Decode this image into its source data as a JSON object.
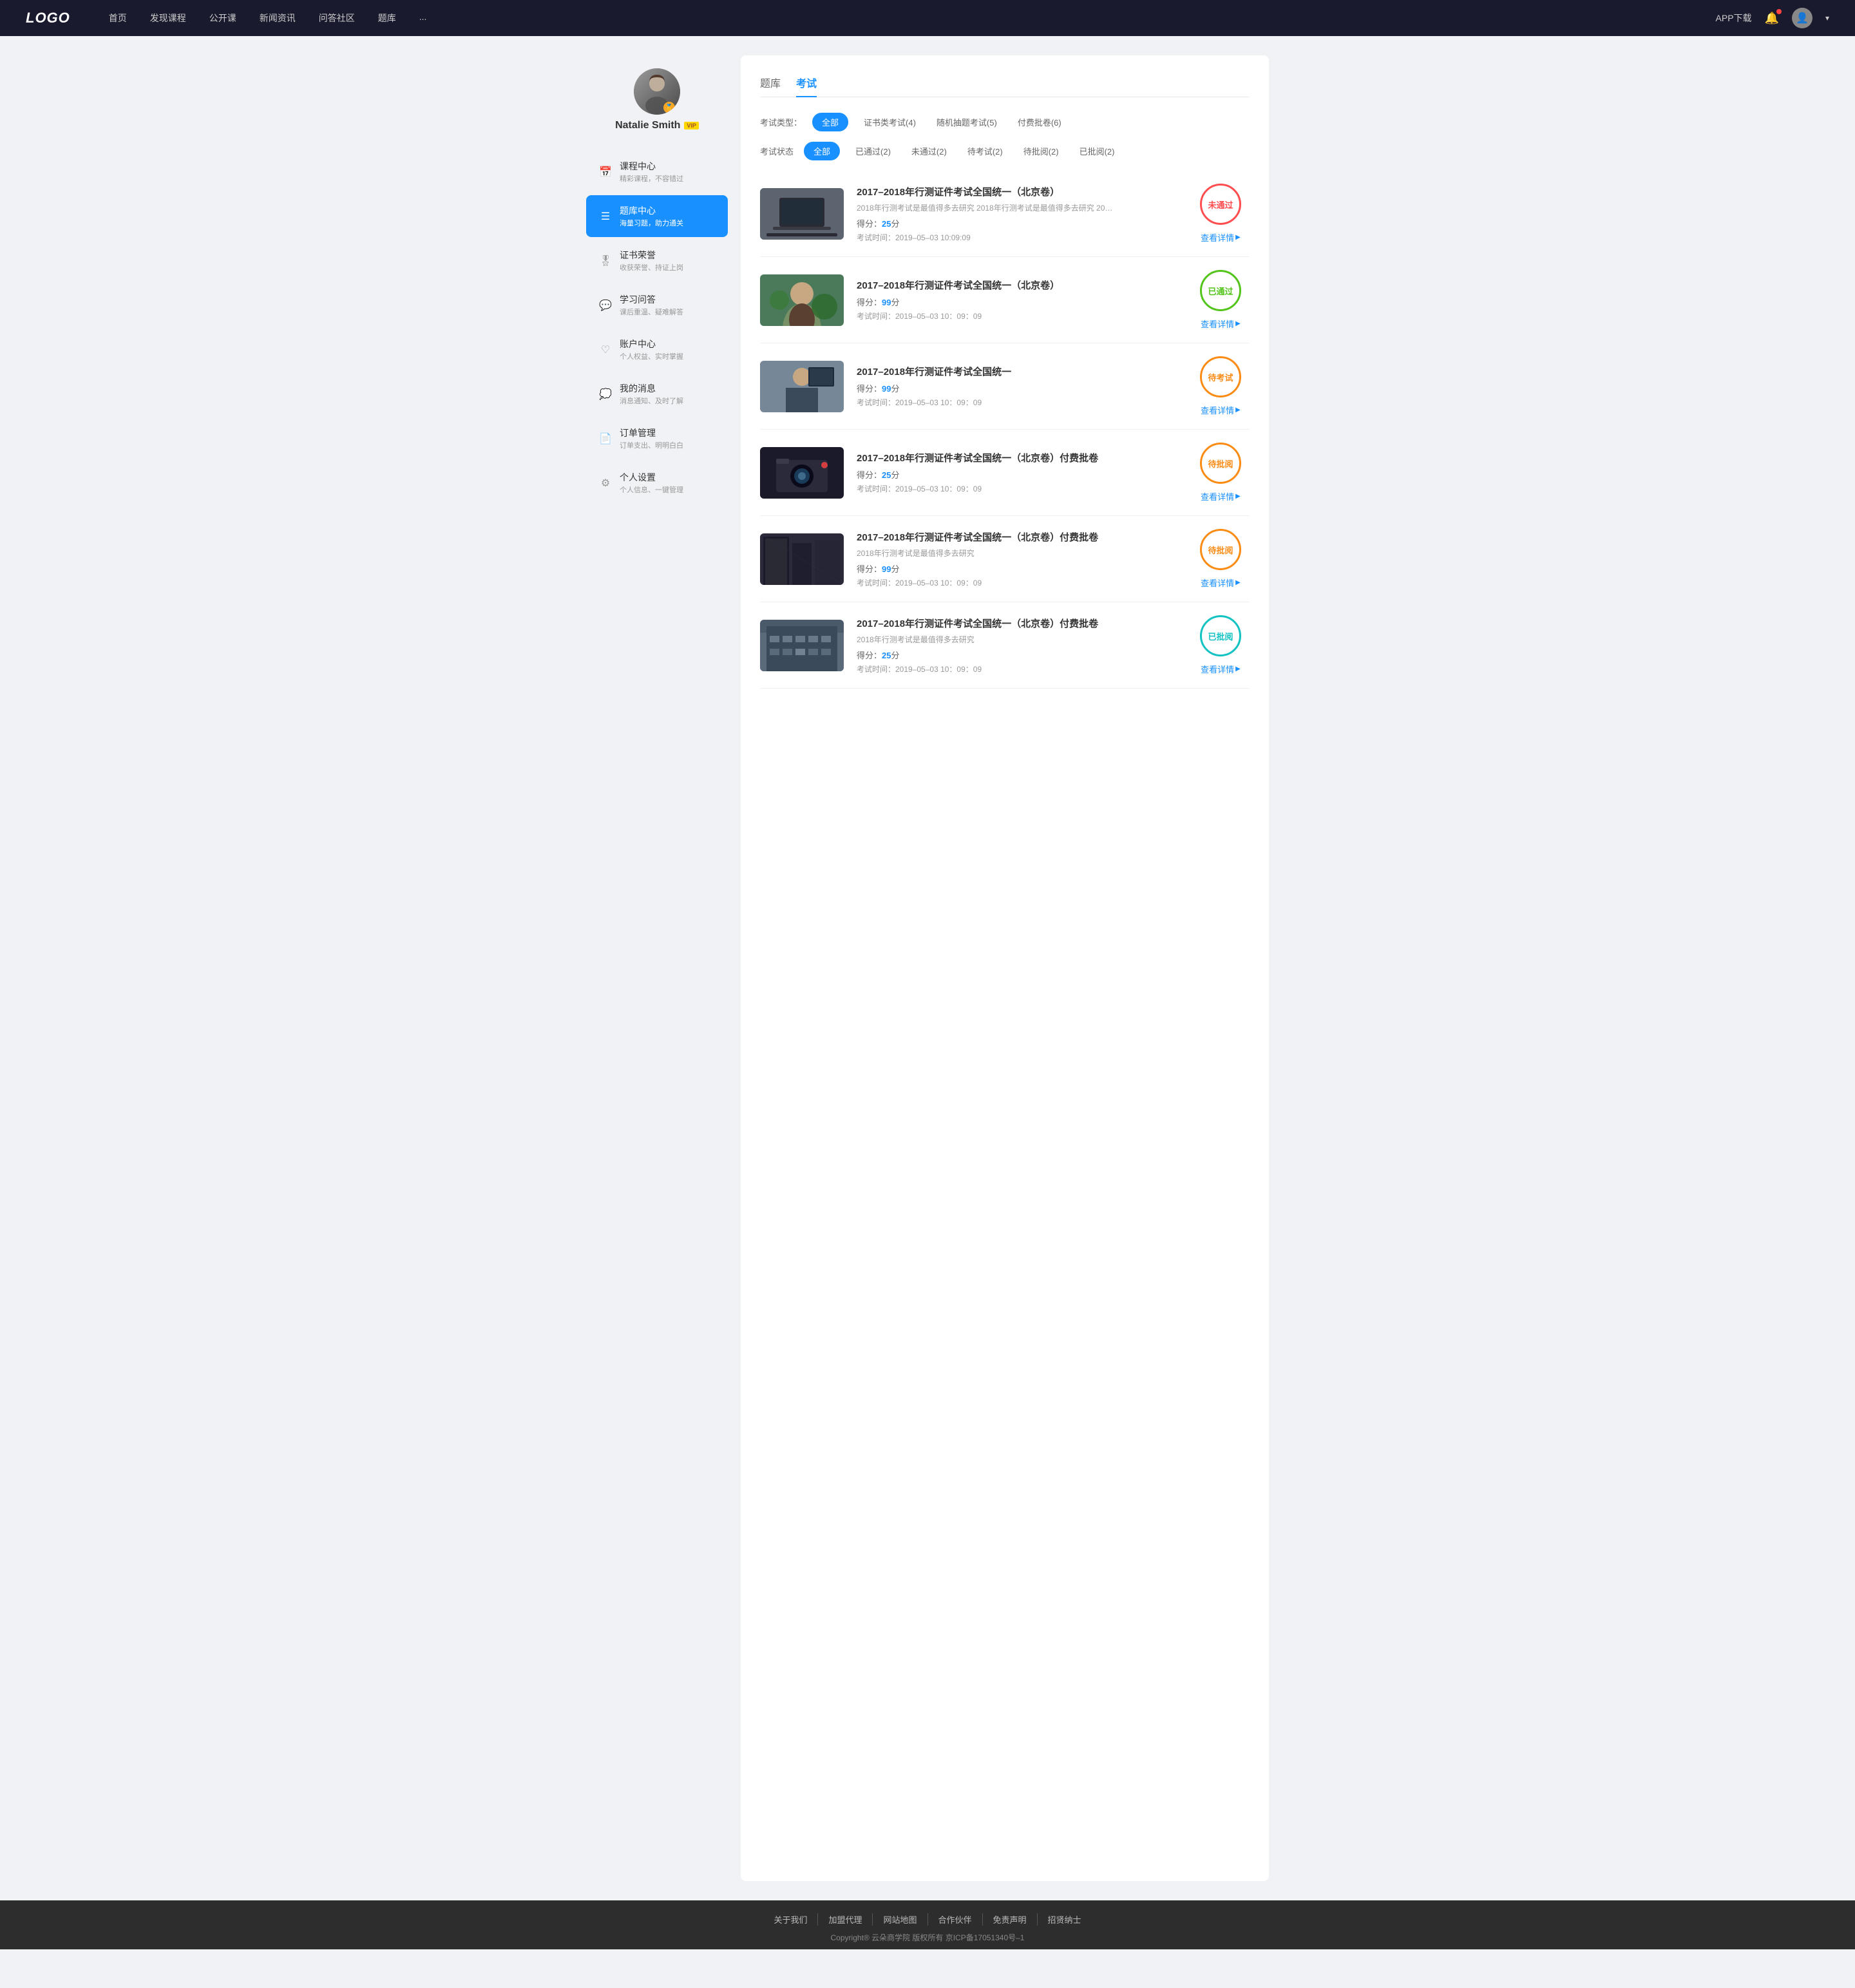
{
  "header": {
    "logo": "LOGO",
    "nav": [
      "首页",
      "发现课程",
      "公开课",
      "新闻资讯",
      "问答社区",
      "题库",
      "..."
    ],
    "app_download": "APP下载"
  },
  "sidebar": {
    "user": {
      "name": "Natalie Smith",
      "vip_label": "VIP"
    },
    "menu": [
      {
        "id": "course",
        "icon": "📅",
        "title": "课程中心",
        "subtitle": "精彩课程，不容错过"
      },
      {
        "id": "question-bank",
        "icon": "☰",
        "title": "题库中心",
        "subtitle": "海量习题，助力通关",
        "active": true
      },
      {
        "id": "certificate",
        "icon": "🏅",
        "title": "证书荣誉",
        "subtitle": "收获荣誉、持证上岗"
      },
      {
        "id": "qa",
        "icon": "💬",
        "title": "学习问答",
        "subtitle": "课后重温、疑难解答"
      },
      {
        "id": "account",
        "icon": "♡",
        "title": "账户中心",
        "subtitle": "个人权益、实时掌握"
      },
      {
        "id": "message",
        "icon": "💭",
        "title": "我的消息",
        "subtitle": "消息通知、及时了解"
      },
      {
        "id": "order",
        "icon": "📄",
        "title": "订单管理",
        "subtitle": "订单支出、明明白白"
      },
      {
        "id": "settings",
        "icon": "⚙",
        "title": "个人设置",
        "subtitle": "个人信息、一键管理"
      }
    ]
  },
  "content": {
    "tabs": [
      "题库",
      "考试"
    ],
    "active_tab": "考试",
    "exam_type_label": "考试类型：",
    "exam_type_filters": [
      {
        "label": "全部",
        "active": true
      },
      {
        "label": "证书类考试(4)",
        "active": false
      },
      {
        "label": "随机抽题考试(5)",
        "active": false
      },
      {
        "label": "付费批卷(6)",
        "active": false
      }
    ],
    "exam_status_label": "考试状态",
    "exam_status_filters": [
      {
        "label": "全部",
        "active": true
      },
      {
        "label": "已通过(2)",
        "active": false
      },
      {
        "label": "未通过(2)",
        "active": false
      },
      {
        "label": "待考试(2)",
        "active": false
      },
      {
        "label": "待批阅(2)",
        "active": false
      },
      {
        "label": "已批阅(2)",
        "active": false
      }
    ],
    "exams": [
      {
        "title": "2017–2018年行测证件考试全国统一（北京卷）",
        "desc": "2018年行测考试是最值得多去研究 2018年行测考试是最值得多去研究 2018年行...",
        "score": "25",
        "time": "2019–05–03  10:09:09",
        "status": "failed",
        "status_label": "未通过",
        "thumb_color": "#6d7b8a"
      },
      {
        "title": "2017–2018年行测证件考试全国统一（北京卷）",
        "desc": "",
        "score": "99",
        "time": "2019–05–03  10：09：09",
        "status": "passed",
        "status_label": "已通过",
        "thumb_color": "#5a8a6a"
      },
      {
        "title": "2017–2018年行测证件考试全国统一",
        "desc": "",
        "score": "99",
        "time": "2019–05–03  10：09：09",
        "status": "pending",
        "status_label": "待考试",
        "thumb_color": "#7a6a8a"
      },
      {
        "title": "2017–2018年行测证件考试全国统一（北京卷）付费批卷",
        "desc": "",
        "score": "25",
        "time": "2019–05–03  10：09：09",
        "status": "review-pending",
        "status_label": "待批阅",
        "thumb_color": "#3a3a4a"
      },
      {
        "title": "2017–2018年行测证件考试全国统一（北京卷）付费批卷",
        "desc": "2018年行测考试是最值得多去研究",
        "score": "99",
        "time": "2019–05–03  10：09：09",
        "status": "review-pending",
        "status_label": "待批阅",
        "thumb_color": "#2a2a3a"
      },
      {
        "title": "2017–2018年行测证件考试全国统一（北京卷）付费批卷",
        "desc": "2018年行测考试是最值得多去研究",
        "score": "25",
        "time": "2019–05–03  10：09：09",
        "status": "reviewed",
        "status_label": "已批阅",
        "thumb_color": "#4a5a6a"
      }
    ],
    "view_detail_label": "查看详情"
  },
  "footer": {
    "links": [
      "关于我们",
      "加盟代理",
      "网站地图",
      "合作伙伴",
      "免责声明",
      "招贤纳士"
    ],
    "copyright": "Copyright®  云朵商学院  版权所有     京ICP备17051340号–1"
  },
  "colors": {
    "active_blue": "#1890ff",
    "failed_red": "#ff4d4f",
    "passed_green": "#52c41a",
    "pending_orange": "#fa8c16",
    "reviewed_teal": "#13c2c2"
  }
}
